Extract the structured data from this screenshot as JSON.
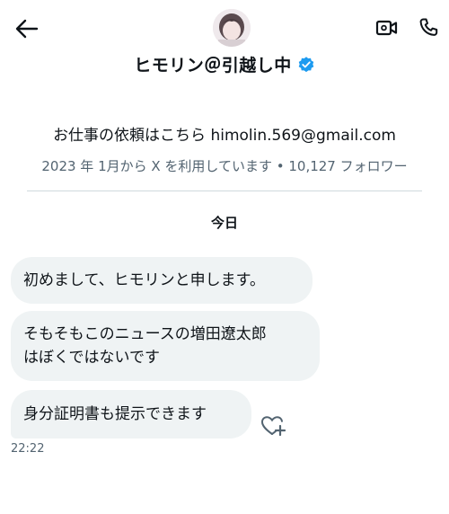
{
  "header": {
    "title": "ヒモリン＠引越し中",
    "verified": true,
    "accent_color": "#1d9bf0"
  },
  "profile": {
    "bio": "お仕事の依頼はこちら himolin.569@gmail.com",
    "meta": "2023 年 1月から X を利用しています • 10,127 フォロワー"
  },
  "conversation": {
    "day_label": "今日",
    "messages": [
      {
        "text": "初めまして、ヒモリンと申します。"
      },
      {
        "line1": "そもそもこのニュースの増田遼太郎",
        "line2": "はぼくではないです"
      },
      {
        "text": "身分証明書も提示できます"
      }
    ],
    "last_time": "22:22"
  },
  "icons": [
    "back-arrow-icon",
    "video-call-icon",
    "phone-icon",
    "verified-badge-icon",
    "add-reaction-icon"
  ]
}
